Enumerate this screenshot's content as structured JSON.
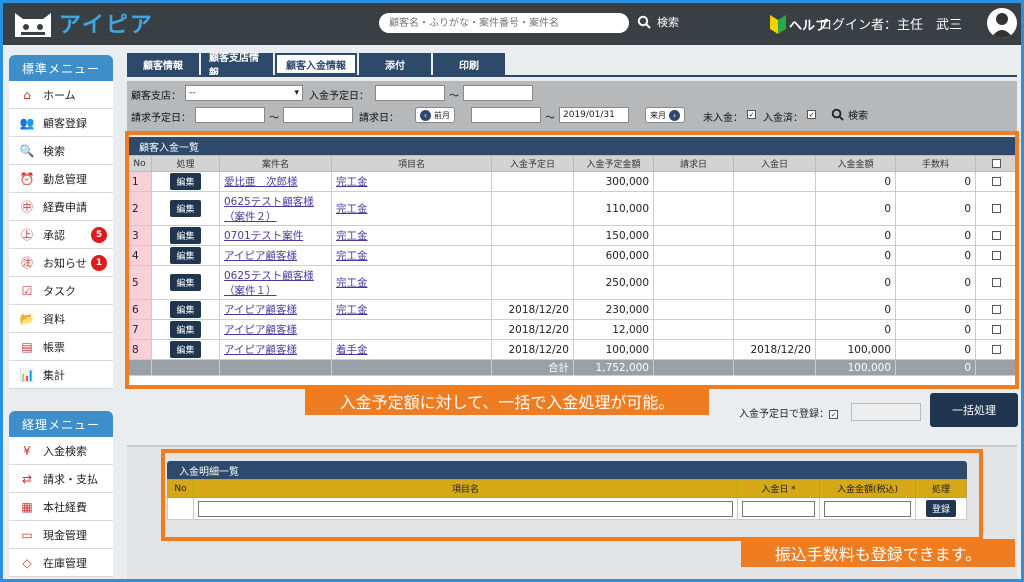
{
  "header": {
    "app_name": "アイピア",
    "search_placeholder": "顧客名・ふりがな・案件番号・案件名",
    "search_label": "検索",
    "help_label": "ヘルプ",
    "login_label": "ログイン者：主任　武三"
  },
  "sidebar": {
    "standard_title": "標準メニュー",
    "standard_items": [
      {
        "label": "ホーム",
        "icon": "home-icon"
      },
      {
        "label": "顧客登録",
        "icon": "users-icon"
      },
      {
        "label": "検索",
        "icon": "search-doc-icon"
      },
      {
        "label": "勤怠管理",
        "icon": "clock-icon"
      },
      {
        "label": "経費申請",
        "icon": "expense-icon"
      },
      {
        "label": "承認",
        "icon": "approve-icon",
        "badge": "5"
      },
      {
        "label": "お知らせ",
        "icon": "notice-icon",
        "badge": "1"
      },
      {
        "label": "タスク",
        "icon": "task-icon"
      },
      {
        "label": "資料",
        "icon": "folder-icon"
      },
      {
        "label": "帳票",
        "icon": "report-icon"
      },
      {
        "label": "集計",
        "icon": "chart-icon"
      }
    ],
    "accounting_title": "経理メニュー",
    "accounting_items": [
      {
        "label": "入金検索",
        "icon": "payment-search-icon"
      },
      {
        "label": "請求・支払",
        "icon": "billing-icon"
      },
      {
        "label": "本社経費",
        "icon": "hq-expense-icon"
      },
      {
        "label": "現金管理",
        "icon": "cash-icon"
      },
      {
        "label": "在庫管理",
        "icon": "inventory-icon"
      }
    ]
  },
  "tabs": [
    "顧客情報",
    "顧客支店情報",
    "顧客入金情報",
    "添付",
    "印刷"
  ],
  "active_tab": "顧客入金情報",
  "filter": {
    "branch_label": "顧客支店：",
    "branch_value": "--",
    "due_label": "入金予定日：",
    "tilde": "～",
    "bill_due_label": "請求予定日：",
    "bill_label": "請求日：",
    "prev_month": "前月",
    "next_month": "来月",
    "bill_to": "2019/01/31",
    "unpaid_label": "未入金：",
    "paid_label": "入金済：",
    "search_label": "検索"
  },
  "list": {
    "title": "顧客入金一覧",
    "columns": [
      "No",
      "処理",
      "案件名",
      "項目名",
      "入金予定日",
      "入金予定金額",
      "請求日",
      "入金日",
      "入金金額",
      "手数料",
      ""
    ],
    "edit_label": "編集",
    "rows": [
      {
        "no": "1",
        "case": "愛比亜　次郎様",
        "item": "完工金",
        "due": "",
        "planned": "300,000",
        "bill": "",
        "paid_date": "",
        "paid": "0",
        "fee": "0"
      },
      {
        "no": "2",
        "case": "0625テスト顧客様（案件２）",
        "item": "完工金",
        "due": "",
        "planned": "110,000",
        "bill": "",
        "paid_date": "",
        "paid": "0",
        "fee": "0"
      },
      {
        "no": "3",
        "case": "0701テスト案件",
        "item": "完工金",
        "due": "",
        "planned": "150,000",
        "bill": "",
        "paid_date": "",
        "paid": "0",
        "fee": "0"
      },
      {
        "no": "4",
        "case": "アイピア顧客様",
        "item": "完工金",
        "due": "",
        "planned": "600,000",
        "bill": "",
        "paid_date": "",
        "paid": "0",
        "fee": "0"
      },
      {
        "no": "5",
        "case": "0625テスト顧客様（案件１）",
        "item": "完工金",
        "due": "",
        "planned": "250,000",
        "bill": "",
        "paid_date": "",
        "paid": "0",
        "fee": "0"
      },
      {
        "no": "6",
        "case": "アイピア顧客様",
        "item": "完工金",
        "due": "2018/12/20",
        "planned": "230,000",
        "bill": "",
        "paid_date": "",
        "paid": "0",
        "fee": "0"
      },
      {
        "no": "7",
        "case": "アイピア顧客様",
        "item": "",
        "due": "2018/12/20",
        "planned": "12,000",
        "bill": "",
        "paid_date": "",
        "paid": "0",
        "fee": "0"
      },
      {
        "no": "8",
        "case": "アイピア顧客様",
        "item": "着手金",
        "due": "2018/12/20",
        "planned": "100,000",
        "bill": "",
        "paid_date": "2018/12/20",
        "paid": "100,000",
        "fee": "0"
      }
    ],
    "total_label": "合計",
    "total_planned": "1,752,000",
    "total_paid": "100,000",
    "total_fee": "0"
  },
  "callout_upper": "入金予定額に対して、一括で入金処理が可能。",
  "bulk": {
    "label": "入金予定日で登録：",
    "button": "一括処理"
  },
  "detail": {
    "title": "入金明細一覧",
    "columns": [
      "No",
      "項目名",
      "入金日 *",
      "入金金額(税込)",
      "処理"
    ],
    "register_label": "登録"
  },
  "callout_lower": "振込手数料も登録できます。",
  "colors": {
    "accent": "#3e8fc9",
    "navy": "#2d4a6b",
    "highlight": "#f07c22"
  }
}
